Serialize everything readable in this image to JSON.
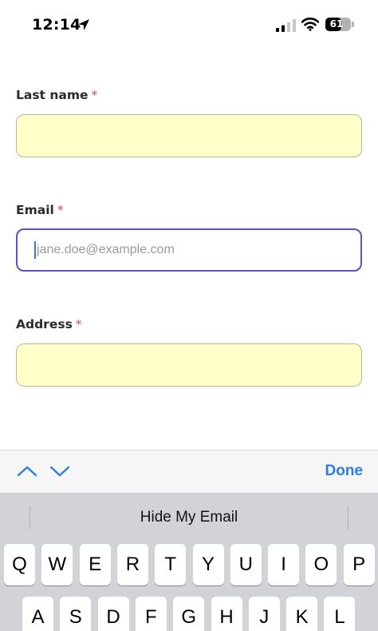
{
  "status_bar": {
    "time": "12:14",
    "battery_level": 61,
    "battery_text": "61"
  },
  "form": {
    "last_name": {
      "label": "Last name",
      "required_mark": "*",
      "value": ""
    },
    "email": {
      "label": "Email",
      "required_mark": "*",
      "placeholder": "jane.doe@example.com",
      "value": ""
    },
    "address": {
      "label": "Address",
      "required_mark": "*",
      "value": ""
    }
  },
  "colors": {
    "input_fill": "#ffffc7",
    "focus_border": "#6a4cc0",
    "required": "#c0564a",
    "accent_blue": "#2f7de1"
  },
  "accessory_bar": {
    "previous_icon": "chevron-up-icon",
    "next_icon": "chevron-down-icon",
    "done_label": "Done"
  },
  "keyboard": {
    "suggestion": "Hide My Email",
    "rows": [
      [
        "Q",
        "W",
        "E",
        "R",
        "T",
        "Y",
        "U",
        "I",
        "O",
        "P"
      ],
      [
        "A",
        "S",
        "D",
        "F",
        "G",
        "H",
        "J",
        "K",
        "L"
      ]
    ]
  }
}
